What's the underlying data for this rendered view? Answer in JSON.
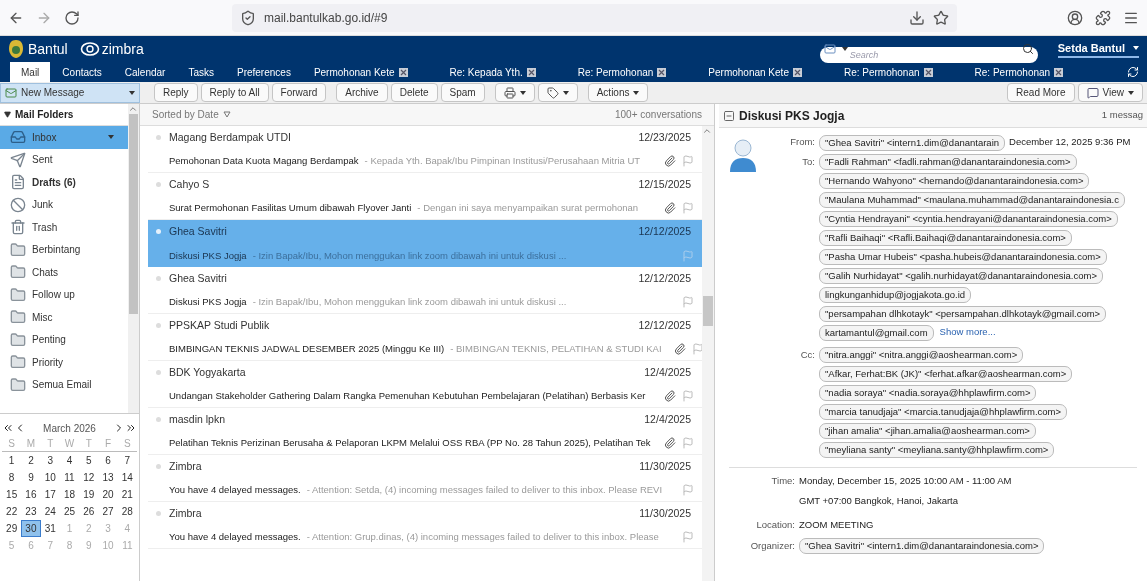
{
  "browser": {
    "url": "mail.bantulkab.go.id/#9"
  },
  "header": {
    "brand": "Bantul",
    "product": "zimbra",
    "search_placeholder": "Search",
    "user": "Setda Bantul"
  },
  "tabs": [
    {
      "label": "Mail",
      "selected": true,
      "closable": false
    },
    {
      "label": "Contacts",
      "selected": false,
      "closable": false
    },
    {
      "label": "Calendar",
      "selected": false,
      "closable": false
    },
    {
      "label": "Tasks",
      "selected": false,
      "closable": false
    },
    {
      "label": "Preferences",
      "selected": false,
      "closable": false
    },
    {
      "label": "Permohonan Kete",
      "selected": false,
      "closable": true
    },
    {
      "label": "Re: Kepada Yth.",
      "selected": false,
      "closable": true
    },
    {
      "label": "Re: Permohonan",
      "selected": false,
      "closable": true
    },
    {
      "label": "Permohonan Kete",
      "selected": false,
      "closable": true
    },
    {
      "label": "Re: Permohonan",
      "selected": false,
      "closable": true
    },
    {
      "label": "Re: Permohonan",
      "selected": false,
      "closable": true
    }
  ],
  "toolbar": [
    {
      "kind": "button",
      "label": "Reply"
    },
    {
      "kind": "button",
      "label": "Reply to All"
    },
    {
      "kind": "button",
      "label": "Forward"
    },
    {
      "kind": "button",
      "label": "Archive"
    },
    {
      "kind": "button",
      "label": "Delete"
    },
    {
      "kind": "button",
      "label": "Spam"
    },
    {
      "kind": "print-menu"
    },
    {
      "kind": "tag-menu"
    },
    {
      "kind": "menu",
      "label": "Actions"
    }
  ],
  "new_message": "New Message",
  "toolbar_right": [
    {
      "kind": "button",
      "label": "Read More"
    },
    {
      "kind": "view-menu",
      "label": "View"
    }
  ],
  "sidebar": {
    "title": "Mail Folders",
    "folders": [
      {
        "kind": "inbox",
        "label": "Inbox",
        "selected": true,
        "unread": false
      },
      {
        "kind": "sent",
        "label": "Sent",
        "selected": false,
        "unread": false
      },
      {
        "kind": "drafts",
        "label": "Drafts (6)",
        "selected": false,
        "unread": true
      },
      {
        "kind": "junk",
        "label": "Junk",
        "selected": false,
        "unread": false
      },
      {
        "kind": "trash",
        "label": "Trash",
        "selected": false,
        "unread": false
      },
      {
        "kind": "folder",
        "label": "Berbintang",
        "selected": false,
        "unread": false
      },
      {
        "kind": "folder",
        "label": "Chats",
        "selected": false,
        "unread": false
      },
      {
        "kind": "folder",
        "label": "Follow up",
        "selected": false,
        "unread": false
      },
      {
        "kind": "folder",
        "label": "Misc",
        "selected": false,
        "unread": false
      },
      {
        "kind": "folder",
        "label": "Penting",
        "selected": false,
        "unread": false
      },
      {
        "kind": "folder",
        "label": "Priority",
        "selected": false,
        "unread": false
      },
      {
        "kind": "folder",
        "label": "Semua Email",
        "selected": false,
        "unread": false
      }
    ]
  },
  "calendar": {
    "month": "March 2026",
    "weekdays": [
      "S",
      "M",
      "T",
      "W",
      "T",
      "F",
      "S"
    ],
    "weeks": [
      [
        {
          "day": "1",
          "outside": false,
          "selected": false
        },
        {
          "day": "2",
          "outside": false,
          "selected": false
        },
        {
          "day": "3",
          "outside": false,
          "selected": false
        },
        {
          "day": "4",
          "outside": false,
          "selected": false
        },
        {
          "day": "5",
          "outside": false,
          "selected": false
        },
        {
          "day": "6",
          "outside": false,
          "selected": false
        },
        {
          "day": "7",
          "outside": false,
          "selected": false
        }
      ],
      [
        {
          "day": "8",
          "outside": false,
          "selected": false
        },
        {
          "day": "9",
          "outside": false,
          "selected": false
        },
        {
          "day": "10",
          "outside": false,
          "selected": false
        },
        {
          "day": "11",
          "outside": false,
          "selected": false
        },
        {
          "day": "12",
          "outside": false,
          "selected": false
        },
        {
          "day": "13",
          "outside": false,
          "selected": false
        },
        {
          "day": "14",
          "outside": false,
          "selected": false
        }
      ],
      [
        {
          "day": "15",
          "outside": false,
          "selected": false
        },
        {
          "day": "16",
          "outside": false,
          "selected": false
        },
        {
          "day": "17",
          "outside": false,
          "selected": false
        },
        {
          "day": "18",
          "outside": false,
          "selected": false
        },
        {
          "day": "19",
          "outside": false,
          "selected": false
        },
        {
          "day": "20",
          "outside": false,
          "selected": false
        },
        {
          "day": "21",
          "outside": false,
          "selected": false
        }
      ],
      [
        {
          "day": "22",
          "outside": false,
          "selected": false
        },
        {
          "day": "23",
          "outside": false,
          "selected": false
        },
        {
          "day": "24",
          "outside": false,
          "selected": false
        },
        {
          "day": "25",
          "outside": false,
          "selected": false
        },
        {
          "day": "26",
          "outside": false,
          "selected": false
        },
        {
          "day": "27",
          "outside": false,
          "selected": false
        },
        {
          "day": "28",
          "outside": false,
          "selected": false
        }
      ],
      [
        {
          "day": "29",
          "outside": false,
          "selected": false
        },
        {
          "day": "30",
          "outside": false,
          "selected": true
        },
        {
          "day": "31",
          "outside": false,
          "selected": false
        },
        {
          "day": "1",
          "outside": true,
          "selected": false
        },
        {
          "day": "2",
          "outside": true,
          "selected": false
        },
        {
          "day": "3",
          "outside": true,
          "selected": false
        },
        {
          "day": "4",
          "outside": true,
          "selected": false
        }
      ],
      [
        {
          "day": "5",
          "outside": true,
          "selected": false
        },
        {
          "day": "6",
          "outside": true,
          "selected": false
        },
        {
          "day": "7",
          "outside": true,
          "selected": false
        },
        {
          "day": "8",
          "outside": true,
          "selected": false
        },
        {
          "day": "9",
          "outside": true,
          "selected": false
        },
        {
          "day": "10",
          "outside": true,
          "selected": false
        },
        {
          "day": "11",
          "outside": true,
          "selected": false
        }
      ]
    ]
  },
  "list": {
    "sort_label": "Sorted by Date",
    "count": "100+ conversations",
    "messages": [
      {
        "sender": "Magang Berdampak UTDI",
        "date": "12/23/2025",
        "subject": "Pemohonan Data Kuota Magang Berdampak",
        "snippet": "- Kepada Yth. Bapak/Ibu Pimpinan Institusi/Perusahaan Mitria UT",
        "attachment": true,
        "selected": false
      },
      {
        "sender": "Cahyo S",
        "date": "12/15/2025",
        "subject": "Surat Permohonan Fasilitas Umum dibawah Flyover Janti",
        "snippet": "- Dengan ini saya menyampaikan surat permohonan",
        "attachment": true,
        "selected": false
      },
      {
        "sender": "Ghea Savitri",
        "date": "12/12/2025",
        "subject": "Diskusi PKS Jogja",
        "snippet": "- Izin Bapak/Ibu, Mohon menggukan link zoom dibawah ini untuk diskusi ...",
        "attachment": false,
        "selected": true
      },
      {
        "sender": "Ghea Savitri",
        "date": "12/12/2025",
        "subject": "Diskusi PKS Jogja",
        "snippet": "- Izin Bapak/Ibu, Mohon menggukan link zoom dibawah ini untuk diskusi ...",
        "attachment": false,
        "selected": false
      },
      {
        "sender": "PPSKAP Studi Publik",
        "date": "12/12/2025",
        "subject": "BIMBINGAN TEKNIS JADWAL DESEMBER 2025 (Minggu Ke III)",
        "snippet": "- BIMBINGAN TEKNIS, PELATIHAN & STUDI KAI",
        "attachment": true,
        "selected": false
      },
      {
        "sender": "BDK Yogyakarta",
        "date": "12/4/2025",
        "subject": "Undangan Stakeholder Gathering Dalam Rangka Pemenuhan Kebutuhan Pembelajaran (Pelatihan) Berbasis Ker",
        "attachment": true,
        "selected": false
      },
      {
        "sender": "masdin lpkn",
        "date": "12/4/2025",
        "subject": "Pelatihan Teknis Perizinan Berusaha & Pelaporan LKPM Melalui OSS RBA (PP No. 28 Tahun 2025), Pelatihan Tek",
        "attachment": true,
        "selected": false
      },
      {
        "sender": "Zimbra",
        "date": "11/30/2025",
        "subject": "You have 4 delayed messages.",
        "snippet": "- Attention: Setda, (4) incoming messages failed to deliver to this inbox. Please REVI",
        "attachment": false,
        "selected": false
      },
      {
        "sender": "Zimbra",
        "date": "11/30/2025",
        "subject": "You have 4 delayed messages.",
        "snippet": "- Attention: Grup.dinas, (4) incoming messages failed to deliver to this inbox. Please",
        "attachment": false,
        "selected": false
      }
    ]
  },
  "reading": {
    "title": "Diskusi PKS Jogja",
    "count": "1 messag",
    "from_label": "From:",
    "from": "\"Ghea Savitri\" <intern1.dim@danantarain",
    "date": "December 12, 2025 9:36 PM",
    "to_label": "To:",
    "to": [
      "\"Fadli Rahman\" <fadli.rahman@danantaraindonesia.com>",
      "\"Hernando Wahyono\" <hernando@danantaraindonesia.com>",
      "\"Maulana Muhammad\" <maulana.muhammad@danantaraindonesia.c",
      "\"Cyntia Hendrayani\" <cyntia.hendrayani@danantaraindonesia.com>",
      "\"Rafli Baihaqi\" <Rafli.Baihaqi@danantaraindonesia.com>",
      "\"Pasha Umar Hubeis\" <pasha.hubeis@danantaraindonesia.com>",
      "\"Galih Nurhidayat\" <galih.nurhidayat@danantaraindonesia.com>",
      "lingkunganhidup@jogjakota.go.id",
      "\"persampahan dlhkotayk\" <persampahan.dlhkotayk@gmail.com>",
      "kartamantul@gmail.com"
    ],
    "show_more": "Show more...",
    "cc_label": "Cc:",
    "cc": [
      "\"nitra.anggi\" <nitra.anggi@aoshearman.com>",
      "\"Afkar, Ferhat:BK (JK)\" <ferhat.afkar@aoshearman.com>",
      "\"nadia soraya\" <nadia.soraya@hhplawfirm.com>",
      "\"marcia tanudjaja\" <marcia.tanudjaja@hhplawfirm.com>",
      "\"jihan amalia\" <jihan.amalia@aoshearman.com>",
      "\"meyliana santy\" <meyliana.santy@hhplawfirm.com>"
    ],
    "time_label": "Time:",
    "time": [
      "Monday, December 15, 2025 10:00 AM - 11:00 AM",
      "GMT +07:00 Bangkok, Hanoi, Jakarta"
    ],
    "location_label": "Location:",
    "location": "ZOOM MEETING",
    "organizer_label": "Organizer:",
    "organizer": "\"Ghea Savitri\" <intern1.dim@danantaraindonesia.com>"
  }
}
